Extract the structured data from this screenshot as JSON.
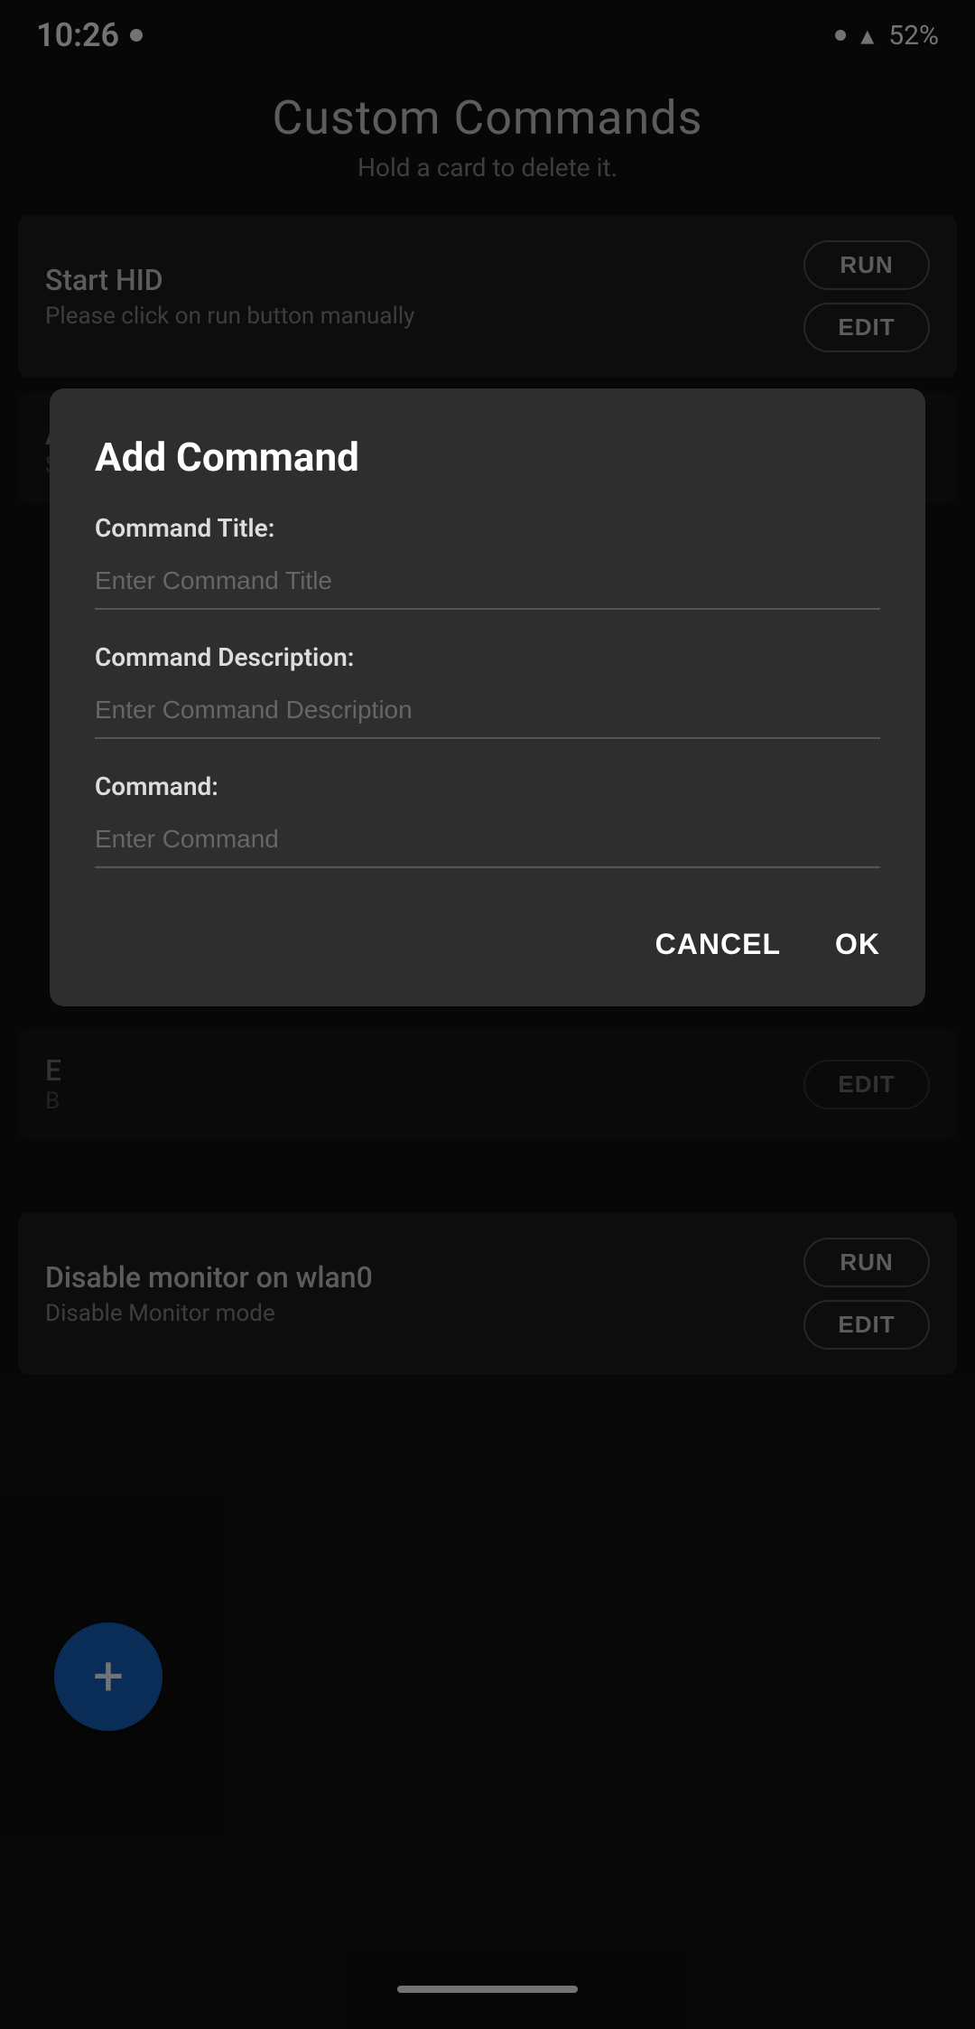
{
  "status_bar": {
    "time": "10:26",
    "battery": "52%"
  },
  "page": {
    "title": "Custom Commands",
    "subtitle": "Hold a card to delete it."
  },
  "cards": [
    {
      "id": "start-hid",
      "title": "Start HID",
      "description": "Please click on run button manually",
      "run_label": "RUN",
      "edit_label": "EDIT"
    },
    {
      "id": "partial-a",
      "title": "A",
      "description": "S",
      "partial": true
    },
    {
      "id": "partial-b",
      "title": "E",
      "description": "B",
      "partial": true,
      "edit_label": "EDIT"
    },
    {
      "id": "disable-monitor",
      "title": "Disable monitor on wlan0",
      "description": "Disable Monitor mode",
      "run_label": "RUN",
      "edit_label": "EDIT"
    }
  ],
  "dialog": {
    "title": "Add Command",
    "fields": [
      {
        "label": "Command Title:",
        "placeholder": "Enter Command Title",
        "name": "command-title-input"
      },
      {
        "label": "Command Description:",
        "placeholder": "Enter Command Description",
        "name": "command-description-input"
      },
      {
        "label": "Command:",
        "placeholder": "Enter Command",
        "name": "command-input"
      }
    ],
    "cancel_label": "CANCEL",
    "ok_label": "OK"
  },
  "fab": {
    "icon": "+"
  },
  "icons": {
    "signal": "◤"
  }
}
